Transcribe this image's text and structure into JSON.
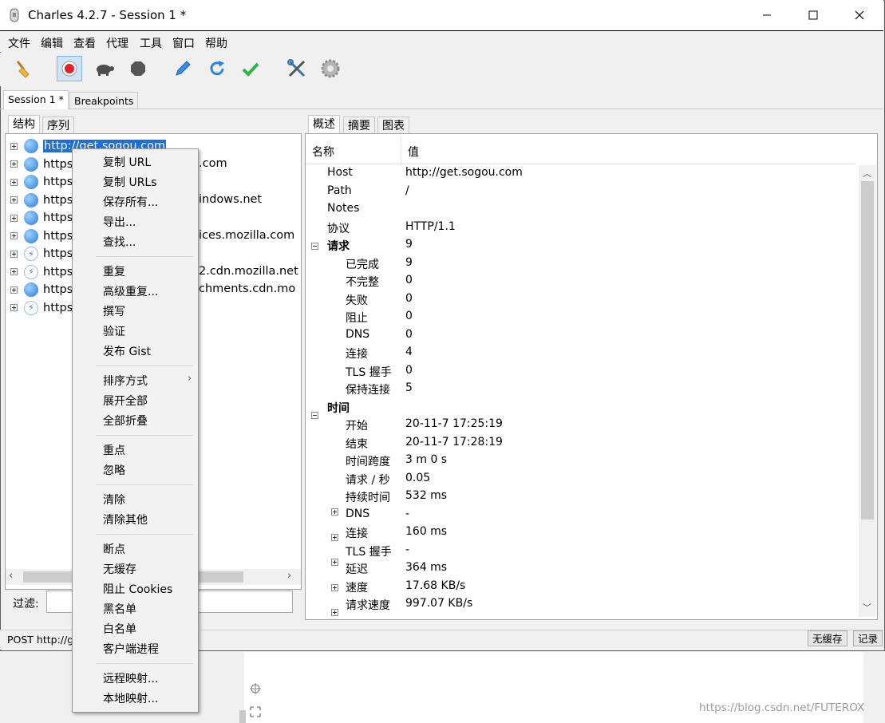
{
  "window": {
    "title": "Charles 4.2.7 - Session 1 *"
  },
  "menu": [
    "文件",
    "编辑",
    "查看",
    "代理",
    "工具",
    "窗口",
    "帮助"
  ],
  "toolbar": [
    "broom-icon",
    "record-icon",
    "turtle-icon",
    "stop-icon",
    "pen-icon",
    "refresh-icon",
    "check-icon",
    "tools-icon",
    "settings-icon"
  ],
  "session_tabs": [
    "Session 1 *",
    "Breakpoints"
  ],
  "left_tabs": [
    "结构",
    "序列"
  ],
  "tree": [
    {
      "text": "http://get.sogou.com",
      "icon": "globe",
      "selected": true
    },
    {
      "text": "https",
      "icon": "globe",
      "tail": ".com"
    },
    {
      "text": "https",
      "icon": "globe",
      "tail": ""
    },
    {
      "text": "https",
      "icon": "globe",
      "tail": "indows.net"
    },
    {
      "text": "https",
      "icon": "globe",
      "tail": ""
    },
    {
      "text": "https",
      "icon": "globe",
      "tail": "ices.mozilla.com"
    },
    {
      "text": "https",
      "icon": "bolt",
      "tail": ""
    },
    {
      "text": "https",
      "icon": "bolt",
      "tail": "2.cdn.mozilla.net"
    },
    {
      "text": "https",
      "icon": "globe",
      "tail": "chments.cdn.mo"
    },
    {
      "text": "https",
      "icon": "bolt",
      "tail": ""
    }
  ],
  "filter": {
    "label": "过滤:",
    "value": ""
  },
  "status": {
    "text": "POST http://ge",
    "no_cache": "无缓存",
    "record": "记录"
  },
  "context_menu": {
    "groups": [
      [
        "复制 URL",
        "复制 URLs",
        "保存所有...",
        "导出...",
        "查找..."
      ],
      [
        "重复",
        "高级重复...",
        "撰写",
        "验证",
        "发布 Gist"
      ],
      [
        "排序方式",
        "展开全部",
        "全部折叠"
      ],
      [
        "重点",
        "忽略"
      ],
      [
        "清除",
        "清除其他"
      ],
      [
        "断点",
        "无缓存",
        "阻止 Cookies",
        "黑名单",
        "白名单",
        "客户端进程"
      ],
      [
        "远程映射...",
        "本地映射..."
      ]
    ]
  },
  "right_tabs": [
    "概述",
    "摘要",
    "图表"
  ],
  "table_header": {
    "name": "名称",
    "value": "值"
  },
  "overview": [
    {
      "label": "Host",
      "value": "http://get.sogou.com",
      "level": 0
    },
    {
      "label": "Path",
      "value": "/",
      "level": 0
    },
    {
      "label": "Notes",
      "value": "",
      "level": 0
    },
    {
      "label": "协议",
      "value": "HTTP/1.1",
      "level": 0
    },
    {
      "label": "请求",
      "value": "9",
      "level": -1,
      "bold": true,
      "box": "minus"
    },
    {
      "label": "已完成",
      "value": "9",
      "level": 1
    },
    {
      "label": "不完整",
      "value": "0",
      "level": 1
    },
    {
      "label": "失败",
      "value": "0",
      "level": 1
    },
    {
      "label": "阻止",
      "value": "0",
      "level": 1
    },
    {
      "label": "DNS",
      "value": "0",
      "level": 1
    },
    {
      "label": "连接",
      "value": "4",
      "level": 1
    },
    {
      "label": "TLS 握手",
      "value": "0",
      "level": 1
    },
    {
      "label": "保持连接",
      "value": "5",
      "level": 1
    },
    {
      "label": "时间",
      "value": "",
      "level": -1,
      "bold": true,
      "box": "minus"
    },
    {
      "label": "开始",
      "value": "20-11-7 17:25:19",
      "level": 1
    },
    {
      "label": "结束",
      "value": "20-11-7 17:28:19",
      "level": 1
    },
    {
      "label": "时间跨度",
      "value": "3 m 0 s",
      "level": 1
    },
    {
      "label": "请求 / 秒",
      "value": "0.05",
      "level": 1
    },
    {
      "label": "持续时间",
      "value": "532 ms",
      "level": 1,
      "box": "plus"
    },
    {
      "label": "DNS",
      "value": "-",
      "level": 1,
      "box": "plus"
    },
    {
      "label": "连接",
      "value": "160 ms",
      "level": 1,
      "box": "plus"
    },
    {
      "label": "TLS 握手",
      "value": "-",
      "level": 1,
      "box": "plus"
    },
    {
      "label": "延迟",
      "value": "364 ms",
      "level": 1,
      "box": "plus"
    },
    {
      "label": "速度",
      "value": "17.68 KB/s",
      "level": 1,
      "box": "plus"
    },
    {
      "label": "请求速度",
      "value": "997.07 KB/s",
      "level": 1,
      "box": "plus"
    }
  ],
  "watermark": "https://blog.csdn.net/FUTEROX"
}
